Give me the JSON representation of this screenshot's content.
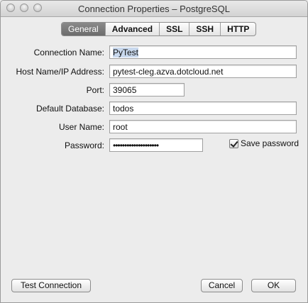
{
  "window": {
    "title": "Connection Properties – PostgreSQL"
  },
  "tabs": [
    {
      "label": "General",
      "active": true
    },
    {
      "label": "Advanced"
    },
    {
      "label": "SSL"
    },
    {
      "label": "SSH"
    },
    {
      "label": "HTTP"
    }
  ],
  "form": {
    "connection_name": {
      "label": "Connection Name:",
      "value": "PyTest"
    },
    "host": {
      "label": "Host Name/IP Address:",
      "value": "pytest-cleg.azva.dotcloud.net"
    },
    "port": {
      "label": "Port:",
      "value": "39065"
    },
    "database": {
      "label": "Default Database:",
      "value": "todos"
    },
    "user": {
      "label": "User Name:",
      "value": "root"
    },
    "password": {
      "label": "Password:",
      "value": "••••••••••••••••••••"
    },
    "save_password": {
      "label": "Save password",
      "checked": true
    }
  },
  "buttons": {
    "test": "Test Connection",
    "cancel": "Cancel",
    "ok": "OK"
  }
}
